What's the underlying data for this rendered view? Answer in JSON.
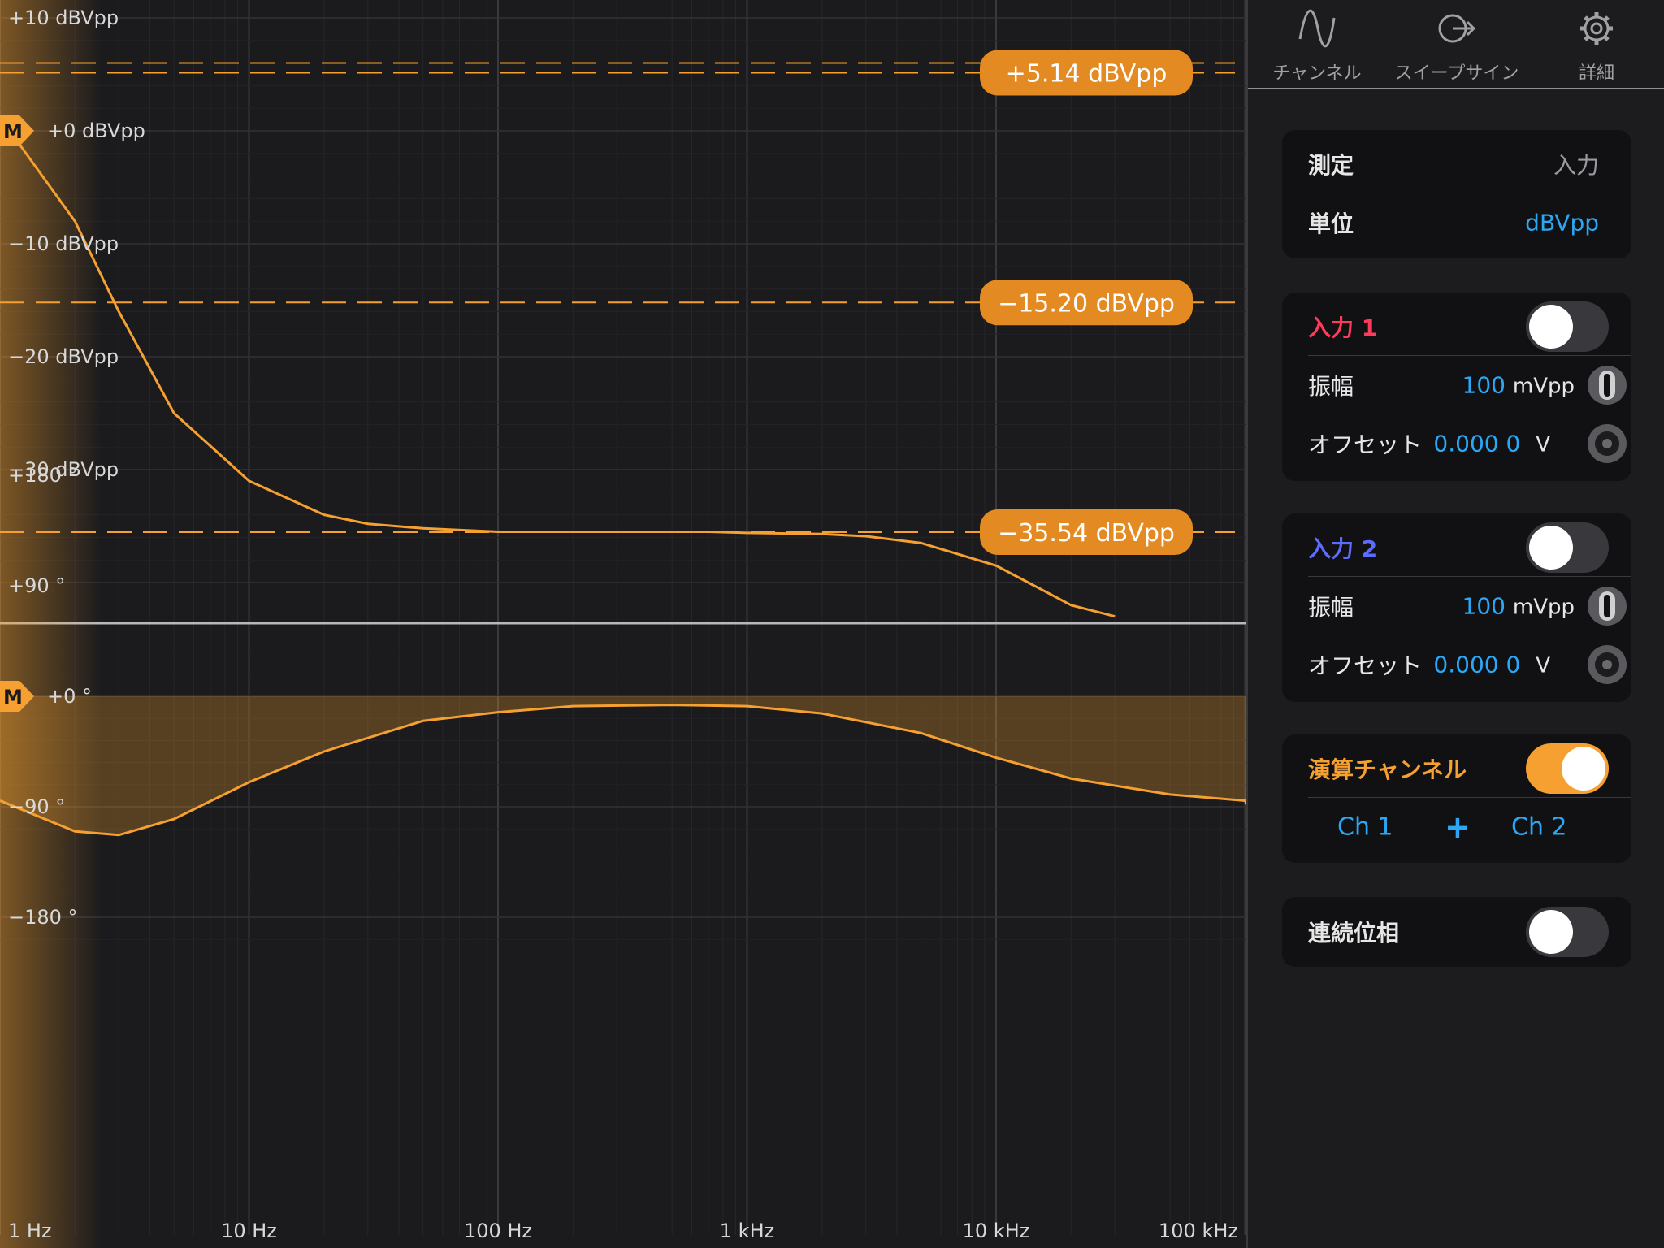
{
  "plot": {
    "chart_data": [
      {
        "type": "line",
        "scale_x": "log",
        "x_ticks": [
          "1 Hz",
          "10 Hz",
          "100 Hz",
          "1 kHz",
          "10 kHz",
          "100 kHz"
        ],
        "y_ticks": [
          "+10 dBVpp",
          "+0 dBVpp",
          "−10 dBVpp",
          "−20 dBVpp",
          "−30 dBVpp"
        ],
        "ylim": [
          -43,
          10
        ],
        "series": [
          {
            "color": "#f5a030",
            "x": [
              1,
              2,
              3,
              5,
              10,
              20,
              30,
              50,
              100,
              200,
              400,
              700,
              1000,
              2000,
              3000,
              5000,
              10000,
              20000,
              30000
            ],
            "y": [
              1.2,
              -8,
              -16,
              -25,
              -31,
              -34,
              -34.8,
              -35.2,
              -35.5,
              -35.5,
              -35.5,
              -35.5,
              -35.6,
              -35.7,
              -35.9,
              -36.5,
              -38.5,
              -42,
              -43
            ]
          }
        ],
        "markers": [
          {
            "label": "+5.14 dBVpp",
            "value": 5.14
          },
          {
            "label": "−15.20 dBVpp",
            "value": -15.2
          },
          {
            "label": "−35.54 dBVpp",
            "value": -35.54
          }
        ],
        "reference_marker": {
          "badge": "M",
          "value": 0
        }
      },
      {
        "type": "area",
        "scale_x": "log",
        "x_ticks": [
          "1 Hz",
          "10 Hz",
          "100 Hz",
          "1 kHz",
          "10 kHz",
          "100 kHz"
        ],
        "y_ticks": [
          "+180 °",
          "+90 °",
          "+0 °",
          "−90 °",
          "−180 °"
        ],
        "ylim": [
          -210,
          210
        ],
        "series": [
          {
            "color": "#f5a030",
            "x": [
              1,
              2,
              3,
              5,
              10,
              20,
              50,
              100,
              200,
              500,
              1000,
              2000,
              5000,
              10000,
              20000,
              50000,
              100000,
              150000
            ],
            "y": [
              -85,
              -110,
              -113,
              -100,
              -70,
              -45,
              -20,
              -13,
              -8,
              -7,
              -8,
              -14,
              -30,
              -50,
              -67,
              -80,
              -85,
              -88
            ]
          }
        ],
        "reference_marker": {
          "badge": "M",
          "value": 0
        }
      }
    ]
  },
  "tabs": [
    {
      "label": "チャンネル",
      "icon": "sine-wave-icon"
    },
    {
      "label": "スイープサイン",
      "icon": "sweep-export-icon"
    },
    {
      "label": "詳細",
      "icon": "gear-icon"
    }
  ],
  "measure_card": {
    "measure_label": "測定",
    "measure_value": "入力",
    "unit_label": "単位",
    "unit_value": "dBVpp"
  },
  "input1": {
    "title": "入力 1",
    "title_color": "#ff3b5c",
    "enabled": false,
    "amplitude_label": "振幅",
    "amplitude_value": "100",
    "amplitude_unit": "mVpp",
    "offset_label": "オフセット",
    "offset_value": "0.000 0",
    "offset_unit": "V"
  },
  "input2": {
    "title": "入力 2",
    "title_color": "#5b6cff",
    "enabled": false,
    "amplitude_label": "振幅",
    "amplitude_value": "100",
    "amplitude_unit": "mVpp",
    "offset_label": "オフセット",
    "offset_value": "0.000 0",
    "offset_unit": "V"
  },
  "math": {
    "title": "演算チャンネル",
    "title_color": "#f5a030",
    "enabled": true,
    "operand1": "Ch 1",
    "operator": "+",
    "operand2": "Ch 2"
  },
  "continuous_phase": {
    "label": "連続位相",
    "enabled": false
  }
}
